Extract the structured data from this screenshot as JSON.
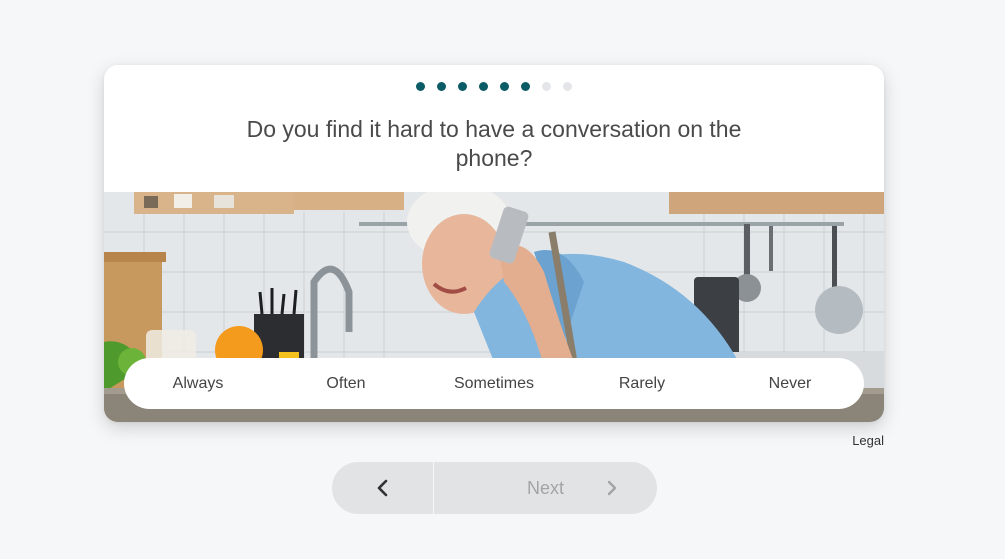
{
  "progress": {
    "total_steps": 8,
    "completed_steps": 6
  },
  "question": {
    "text": "Do you find it hard to have a conversation on the phone?"
  },
  "photo": {
    "subject": "woman-on-phone-in-kitchen"
  },
  "answers": [
    {
      "label": "Always"
    },
    {
      "label": "Often"
    },
    {
      "label": "Sometimes"
    },
    {
      "label": "Rarely"
    },
    {
      "label": "Never"
    }
  ],
  "footer": {
    "legal_label": "Legal"
  },
  "navigation": {
    "back_icon": "chevron-left-icon",
    "next_label": "Next",
    "next_icon": "chevron-right-icon"
  },
  "colors": {
    "accent": "#0b5c66",
    "dot_inactive": "#e3e5e8",
    "nav_background": "#e2e3e5",
    "page_background": "#f6f7f9"
  }
}
